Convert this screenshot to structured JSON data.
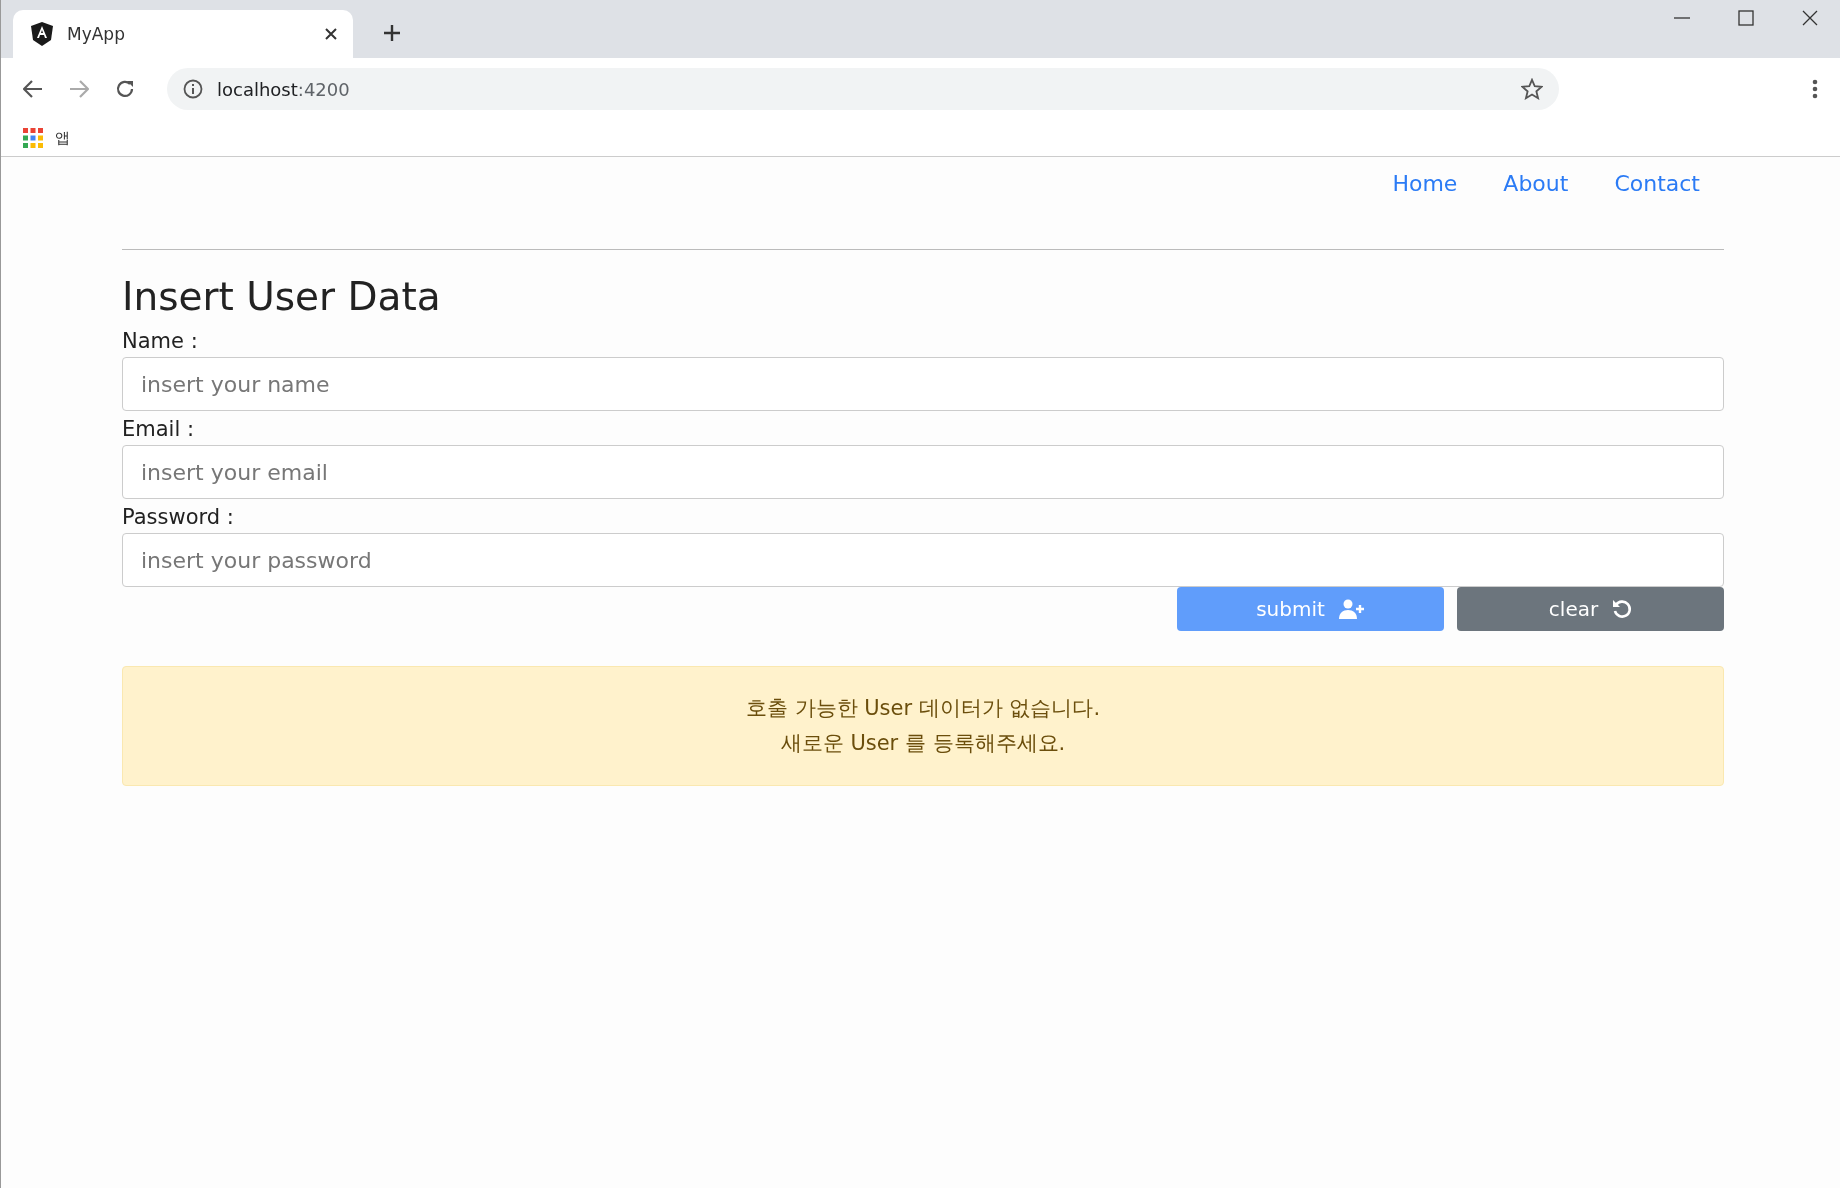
{
  "browser": {
    "tab_title": "MyApp",
    "url_host": "localhost",
    "url_port": ":4200",
    "bookmark": "앱"
  },
  "nav": [
    "Home",
    "About",
    "Contact"
  ],
  "title": "Insert User Data",
  "fields": [
    {
      "label": "Name :",
      "placeholder": "insert your name"
    },
    {
      "label": "Email :",
      "placeholder": "insert your email"
    },
    {
      "label": "Password :",
      "placeholder": "insert your password"
    }
  ],
  "buttons": [
    {
      "label": "submit",
      "kind": "submit"
    },
    {
      "label": "clear",
      "kind": "clear"
    }
  ],
  "alert": [
    "호출 가능한 User 데이터가 없습니다.",
    "새로운 User 를 등록해주세요."
  ]
}
